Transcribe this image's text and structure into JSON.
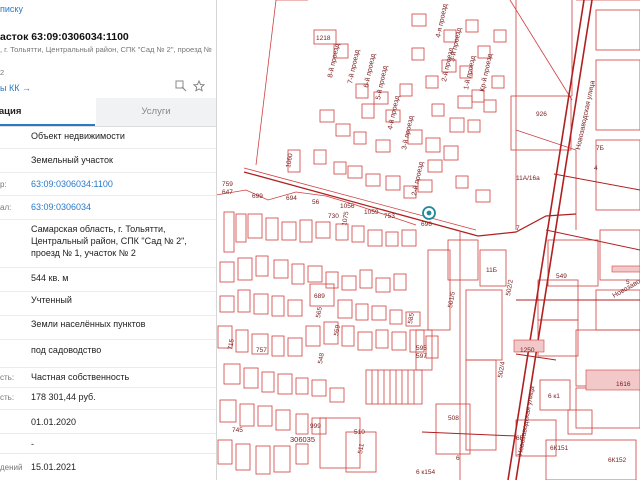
{
  "panel": {
    "back_link": "писку",
    "title": "асток 63:09:0306034:1100",
    "address_line1": ", г. Тольятти, Центральный район, СПК \"Сад № 2\", проезд №",
    "address_line2": "2",
    "kk_link": "ы КК →",
    "tabs": {
      "active": "мация",
      "inactive": "Услуги"
    },
    "rows": [
      {
        "label": "",
        "value": "Объект недвижимости"
      },
      {
        "label": "",
        "value": "Земельный участок"
      },
      {
        "label": "р:",
        "value": "63:09:0306034:1100"
      },
      {
        "label": "ал:",
        "value": "63:09:0306034"
      },
      {
        "label": "",
        "value_lines": [
          "Самарская область, г. Тольятти,",
          "Центральный район, СПК \"Сад № 2\",",
          "проезд № 1, участок № 2"
        ]
      },
      {
        "label": "",
        "value": "544 кв. м"
      },
      {
        "label": "",
        "value": "Учтенный"
      },
      {
        "label": "",
        "value": "Земли населённых пунктов"
      },
      {
        "label": "",
        "value": "под садоводство"
      },
      {
        "label": "сть:",
        "value": "Частная собственность"
      },
      {
        "label": "сть:",
        "value": "178 301,44 руб."
      },
      {
        "label": "",
        "value": "01.01.2020"
      },
      {
        "label": "",
        "value": "-"
      },
      {
        "label": "дений",
        "value": "15.01.2021"
      }
    ]
  },
  "map": {
    "colors": {
      "line": "#d04040",
      "dark_line": "#b02020",
      "fill": "#f2c8c8",
      "marker": "#1f8a9a"
    },
    "road_labels": [
      "8-й проезд",
      "7-й проезд",
      "6-й проезд",
      "5-й проезд",
      "4-й проезд",
      "3-й проезд",
      "2-й проезд",
      "4-я проезд",
      "3-й проезд",
      "2-й проезд",
      "1-й проезд",
      "Кр-й проезд",
      "Новозаводская улица",
      "Новозаводская",
      "Новозаводская улица"
    ],
    "numbers": [
      "1218",
      "1060",
      "759",
      "647",
      "699",
      "694",
      "56",
      "730",
      "1075",
      "1056",
      "1059",
      "753",
      "696",
      "689",
      "565",
      "559",
      "585",
      "757",
      "715",
      "595",
      "597",
      "548",
      "999",
      "745",
      "510",
      "511",
      "508",
      "306035",
      "926",
      "11А/16а",
      "7Б",
      "4",
      "7",
      "11Б",
      "549",
      "501/5",
      "502/2",
      "502/4",
      "6 к1",
      "6Б",
      "6К151",
      "6К152",
      "6 к154",
      "6",
      "1616",
      "1250",
      "5"
    ]
  }
}
